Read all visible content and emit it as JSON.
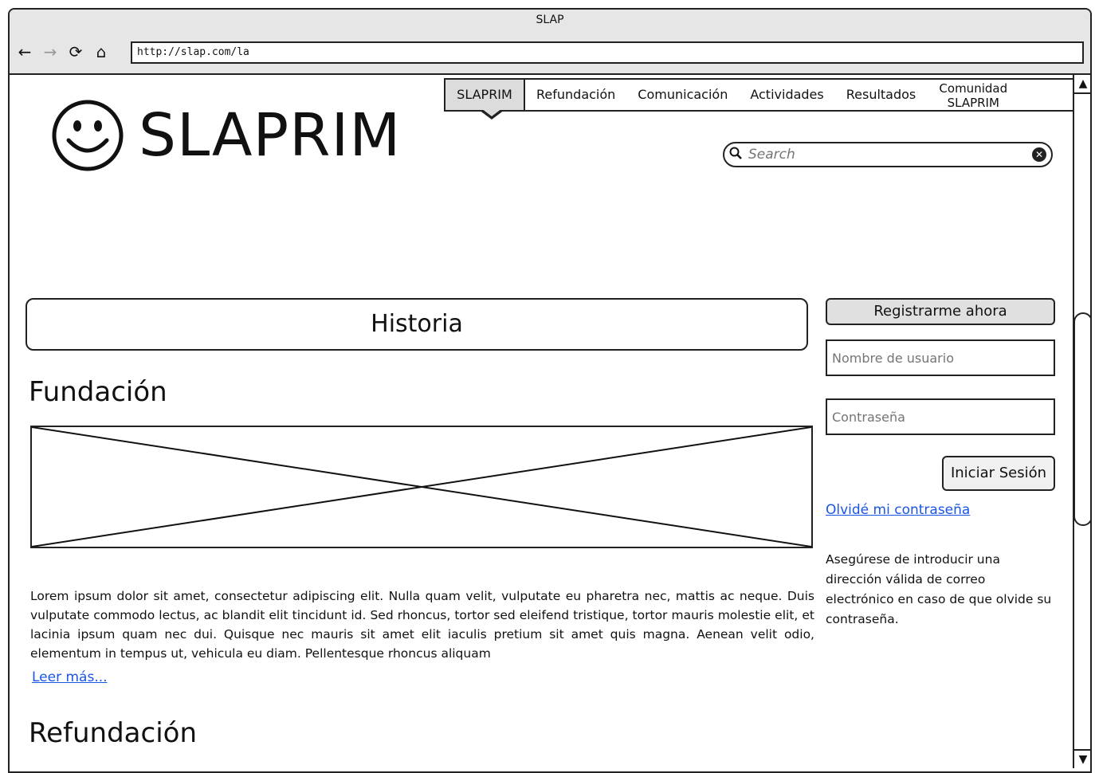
{
  "browser": {
    "title": "SLAP",
    "url": "http://slap.com/la",
    "back_glyph": "←",
    "forward_glyph": "→",
    "reload_glyph": "⟳",
    "home_glyph": "⌂"
  },
  "logo": {
    "text": "SLAPRIM",
    "icon": "smiley-face-icon"
  },
  "topnav": {
    "items": [
      {
        "label": "SLAPRIM",
        "active": true
      },
      {
        "label": "Refundación"
      },
      {
        "label": "Comunicación"
      },
      {
        "label": "Actividades"
      },
      {
        "label": "Resultados"
      },
      {
        "label_line1": "Comunidad",
        "label_line2": "SLAPRIM"
      }
    ]
  },
  "search": {
    "placeholder": "Search",
    "icon": "search-icon",
    "clear_icon": "clear-icon"
  },
  "main": {
    "section_title": "Historia",
    "heading_1": "Fundación",
    "paragraph": "Lorem ipsum dolor sit amet, consectetur adipiscing elit. Nulla quam velit, vulputate eu pharetra nec, mattis ac neque. Duis vulputate commodo lectus, ac blandit elit tincidunt id. Sed rhoncus, tortor sed eleifend tristique, tortor mauris molestie elit, et lacinia ipsum quam nec dui. Quisque nec mauris sit amet elit iaculis pretium sit amet quis magna. Aenean velit odio, elementum in tempus ut, vehicula eu diam. Pellentesque rhoncus aliquam",
    "read_more": "Leer más...",
    "heading_2": "Refundación"
  },
  "sidebar": {
    "register_button": "Registrarme ahora",
    "username_placeholder": "Nombre de usuario",
    "password_placeholder": "Contraseña",
    "login_button": "Iniciar Sesión",
    "forgot_link": "Olvidé mi contraseña",
    "note": "Asegúrese de introducir una dirección válida de correo electrónico en caso de que olvide su contraseña."
  },
  "scrollbar": {
    "up_glyph": "▲",
    "down_glyph": "▼"
  }
}
